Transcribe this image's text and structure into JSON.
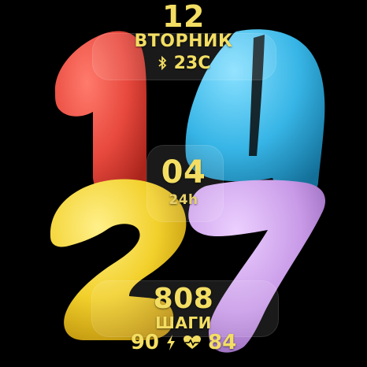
{
  "watch": {
    "date_day": "12",
    "weekday": "ВТОРНИК",
    "temperature": "23C",
    "seconds": "04",
    "time_format": "24h",
    "steps": "808",
    "steps_label": "ШАГИ",
    "battery": "90",
    "heart_rate": "84"
  },
  "big_time": {
    "hour_digits": [
      "1",
      "4"
    ],
    "minute_digits": [
      "2",
      "7"
    ]
  },
  "colors": {
    "text": "#f3de63",
    "digit_1": "#e8493e",
    "digit_4": "#37b5e6",
    "digit_2": "#f2d02b",
    "digit_7": "#c99be8",
    "background": "#000000"
  },
  "icons": {
    "bluetooth": "bluetooth-icon",
    "battery_bolt": "lightning-icon",
    "heart": "heart-pulse-icon"
  }
}
